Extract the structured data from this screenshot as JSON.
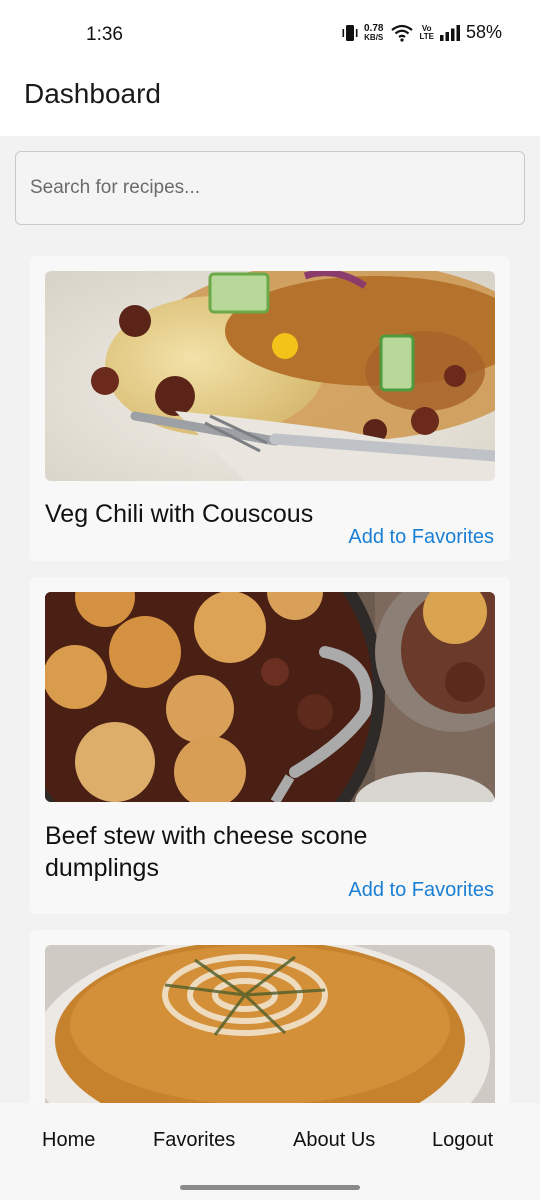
{
  "status_bar": {
    "time": "1:36",
    "net_speed_value": "0.78",
    "net_speed_unit": "KB/S",
    "volte_top": "Vo",
    "volte_bottom": "LTE",
    "battery": "58%",
    "icons": [
      "vibrate-icon",
      "wifi-icon",
      "signal-icon"
    ]
  },
  "header": {
    "title": "Dashboard"
  },
  "search": {
    "placeholder": "Search for recipes..."
  },
  "recipes": [
    {
      "title": "Veg Chili with Couscous",
      "action": "Add to Favorites"
    },
    {
      "title": "Beef stew with cheese scone dumplings",
      "action": "Add to Favorites"
    },
    {
      "title": "",
      "action": ""
    }
  ],
  "nav": {
    "home": "Home",
    "favorites": "Favorites",
    "about": "About Us",
    "logout": "Logout"
  },
  "colors": {
    "accent": "#1a7fd4",
    "background": "#f2f2f2",
    "card": "#f8f8f8"
  }
}
